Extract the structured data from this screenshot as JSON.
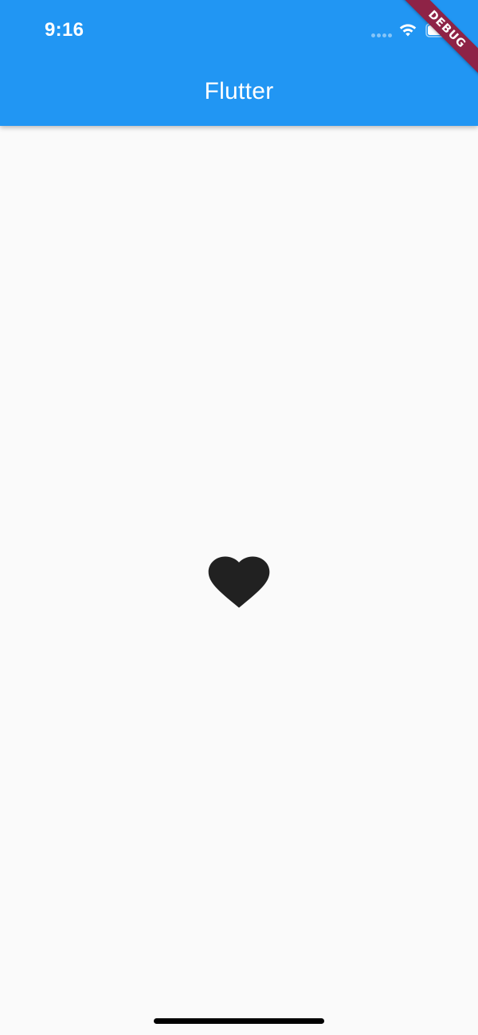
{
  "status_bar": {
    "time": "9:16",
    "wifi_icon": "wifi-icon",
    "battery_icon": "battery-icon",
    "signal_icon": "signal-dots-icon"
  },
  "app_bar": {
    "title": "Flutter",
    "background_color": "#2196f3"
  },
  "debug_banner": {
    "label": "DEBUG",
    "color": "#8e2346"
  },
  "content": {
    "icon": "heart-icon",
    "icon_color": "#212121",
    "background_color": "#fafafa"
  },
  "home_indicator": {
    "icon": "home-indicator-bar"
  }
}
